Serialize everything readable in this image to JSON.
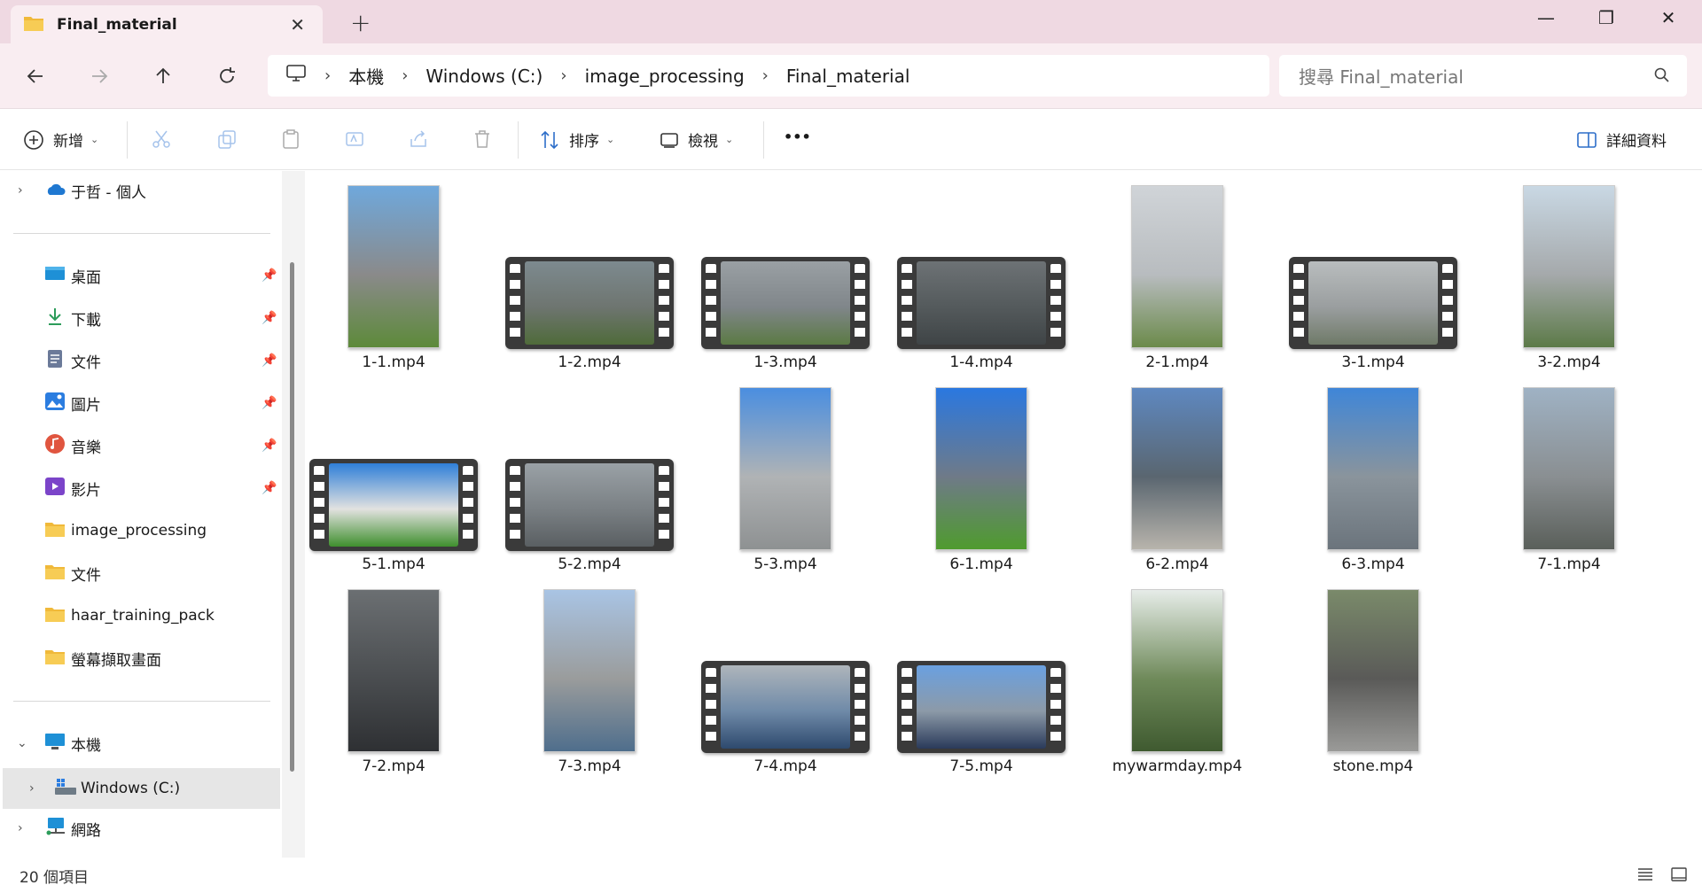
{
  "window": {
    "tab_title": "Final_material",
    "tab_close": "✕",
    "new_tab": "+",
    "minimize": "—",
    "maximize": "❐",
    "close": "✕"
  },
  "nav": {
    "back_icon": "arrow-left-icon",
    "forward_icon": "arrow-right-icon",
    "up_icon": "arrow-up-icon",
    "refresh_icon": "refresh-icon"
  },
  "address": {
    "crumbs": [
      "本機",
      "Windows (C:)",
      "image_processing",
      "Final_material"
    ],
    "separator": "›"
  },
  "search": {
    "placeholder": "搜尋 Final_material"
  },
  "toolbar": {
    "new_label": "新增",
    "sort_label": "排序",
    "view_label": "檢視",
    "more_label": "•••",
    "details_label": "詳細資料"
  },
  "sidebar": {
    "onedrive": "于哲 - 個人",
    "quick": [
      {
        "label": "桌面",
        "icon": "desktop-icon",
        "color": "#1e90d6"
      },
      {
        "label": "下載",
        "icon": "download-icon",
        "color": "#2c9c5a"
      },
      {
        "label": "文件",
        "icon": "document-icon",
        "color": "#6b7a99"
      },
      {
        "label": "圖片",
        "icon": "pictures-icon",
        "color": "#2b7de0"
      },
      {
        "label": "音樂",
        "icon": "music-icon",
        "color": "#e0553f"
      },
      {
        "label": "影片",
        "icon": "videos-icon",
        "color": "#7b44c9"
      }
    ],
    "folders": [
      "image_processing",
      "文件",
      "haar_training_pack",
      "螢幕擷取畫面"
    ],
    "this_pc": "本機",
    "drive": "Windows (C:)",
    "network": "網路"
  },
  "files": [
    {
      "name": "1-1.mp4",
      "type": "vertical",
      "colors": [
        "#6fa8dc",
        "#8a8a8a",
        "#5d8a3a"
      ]
    },
    {
      "name": "1-2.mp4",
      "type": "horizontal",
      "colors": [
        "#7d8a8f",
        "#6e7570",
        "#4f6b3a"
      ]
    },
    {
      "name": "1-3.mp4",
      "type": "horizontal",
      "colors": [
        "#9aa0a4",
        "#80868a",
        "#5b7a44"
      ]
    },
    {
      "name": "1-4.mp4",
      "type": "horizontal",
      "colors": [
        "#6d7275",
        "#545a5c",
        "#3f4446"
      ]
    },
    {
      "name": "2-1.mp4",
      "type": "vertical",
      "colors": [
        "#d0d4d8",
        "#b8bcbf",
        "#6b8a4a"
      ]
    },
    {
      "name": "3-1.mp4",
      "type": "horizontal",
      "colors": [
        "#b9bdbe",
        "#9a9e9f",
        "#6f7a68"
      ]
    },
    {
      "name": "3-2.mp4",
      "type": "vertical",
      "colors": [
        "#c9d8e4",
        "#a5a9ab",
        "#5c7a48"
      ]
    },
    {
      "name": "5-1.mp4",
      "type": "horizontal",
      "colors": [
        "#2f7fd8",
        "#e2e2e0",
        "#3f8f2e"
      ]
    },
    {
      "name": "5-2.mp4",
      "type": "horizontal",
      "colors": [
        "#9aa1a6",
        "#7a8084",
        "#5a5f62"
      ]
    },
    {
      "name": "5-3.mp4",
      "type": "vertical",
      "colors": [
        "#4a8ee0",
        "#b0b3b5",
        "#8e9192"
      ]
    },
    {
      "name": "6-1.mp4",
      "type": "vertical",
      "colors": [
        "#2a78e0",
        "#6f7a88",
        "#4f9b2e"
      ]
    },
    {
      "name": "6-2.mp4",
      "type": "vertical",
      "colors": [
        "#5e88c0",
        "#5a6670",
        "#b8b4ac"
      ]
    },
    {
      "name": "6-3.mp4",
      "type": "vertical",
      "colors": [
        "#3f86d8",
        "#8a949c",
        "#6b747c"
      ]
    },
    {
      "name": "7-1.mp4",
      "type": "vertical",
      "colors": [
        "#9fb2c4",
        "#8a8f92",
        "#5a5f5a"
      ]
    },
    {
      "name": "7-2.mp4",
      "type": "vertical",
      "colors": [
        "#6b6f72",
        "#4a4d50",
        "#2e3033"
      ]
    },
    {
      "name": "7-3.mp4",
      "type": "vertical",
      "colors": [
        "#a9c4e4",
        "#9a9c9c",
        "#4f6e8c"
      ]
    },
    {
      "name": "7-4.mp4",
      "type": "horizontal",
      "colors": [
        "#aeb5bb",
        "#6f8aa8",
        "#2e4a6e"
      ]
    },
    {
      "name": "7-5.mp4",
      "type": "horizontal",
      "colors": [
        "#6aa0e0",
        "#8c9aa8",
        "#2a3a5a"
      ]
    },
    {
      "name": "mywarmday.mp4",
      "type": "vertical",
      "colors": [
        "#e6ece8",
        "#6f8a5a",
        "#3f5a30"
      ]
    },
    {
      "name": "stone.mp4",
      "type": "vertical",
      "colors": [
        "#7a8a6a",
        "#5a5a58",
        "#9a9a98"
      ]
    }
  ],
  "status": {
    "count": "20 個項目"
  }
}
